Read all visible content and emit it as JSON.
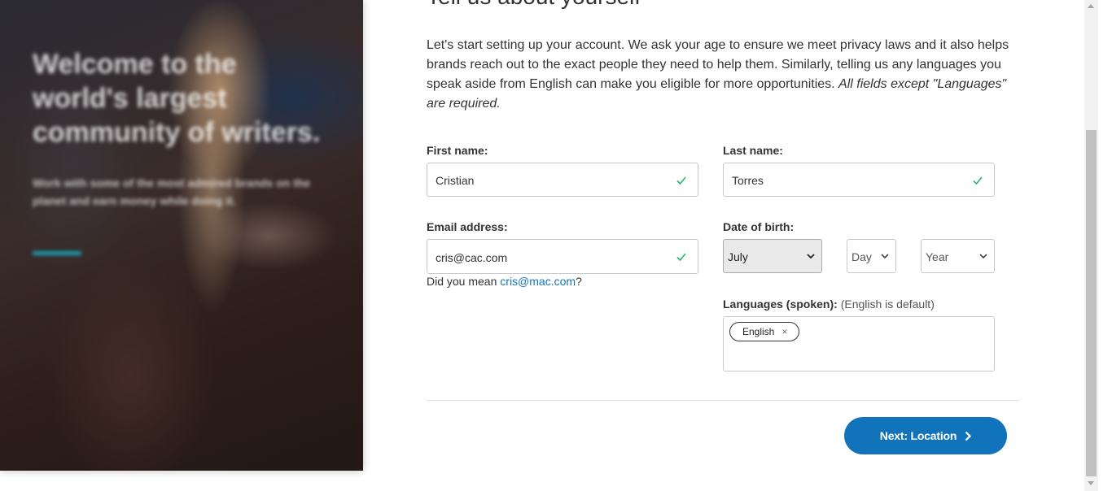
{
  "hero": {
    "title": "Welcome to the world's largest community of writers.",
    "subtitle": "Work with some of the most admired brands on the planet and earn money while doing it."
  },
  "form": {
    "heading": "Tell us about yourself",
    "intro": "Let's start setting up your account. We ask your age to ensure we meet privacy laws and it also helps brands reach out to the exact people they need to help them. Similarly, telling us any languages you speak aside from English can make you eligible for more opportunities.",
    "intro_italic": "All fields except \"Languages\" are required.",
    "first_name": {
      "label": "First name:",
      "value": "Cristian"
    },
    "last_name": {
      "label": "Last name:",
      "value": "Torres"
    },
    "email": {
      "label": "Email address:",
      "value": "cris@cac.com"
    },
    "email_hint": {
      "prefix": "Did you mean ",
      "suggestion": "cris@mac.com",
      "suffix": "?"
    },
    "dob": {
      "label": "Date of birth:",
      "month": "July",
      "day": "Day",
      "year": "Year"
    },
    "languages": {
      "label": "Languages (spoken):",
      "note": "(English is default)",
      "tags": [
        "English"
      ]
    },
    "next_button": "Next: Location"
  },
  "colors": {
    "primary": "#1173b9",
    "link": "#1476b8",
    "valid": "#2bb673"
  }
}
